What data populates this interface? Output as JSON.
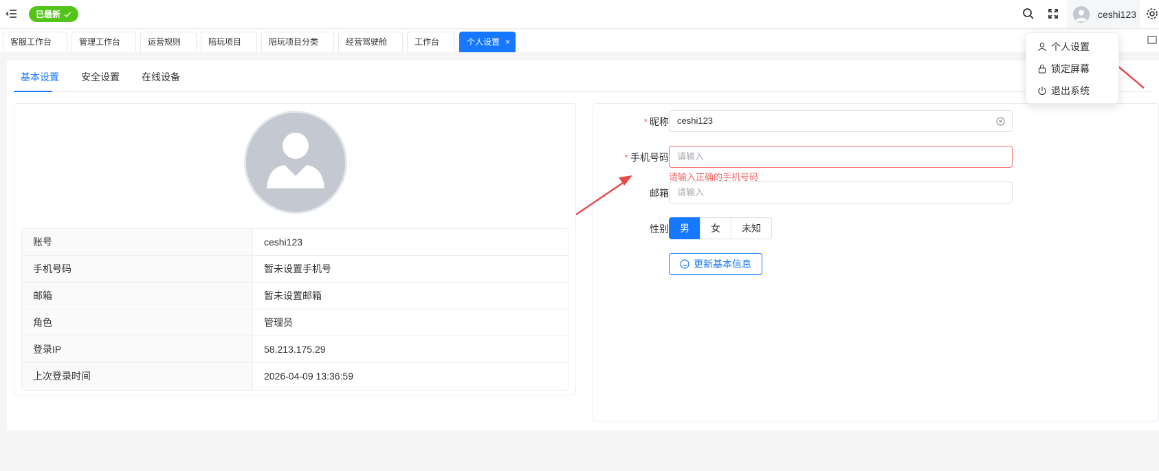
{
  "header": {
    "status_label": "已最新",
    "username": "ceshi123"
  },
  "tabs": [
    {
      "label": "客服工作台"
    },
    {
      "label": "管理工作台"
    },
    {
      "label": "运营规则"
    },
    {
      "label": "陪玩项目"
    },
    {
      "label": "陪玩项目分类"
    },
    {
      "label": "经营驾驶舱"
    },
    {
      "label": "工作台"
    },
    {
      "label": "个人设置",
      "close": "×"
    }
  ],
  "subtabs": [
    {
      "label": "基本设置"
    },
    {
      "label": "安全设置"
    },
    {
      "label": "在线设备"
    }
  ],
  "profile": {
    "rows": [
      {
        "label": "账号",
        "value": "ceshi123"
      },
      {
        "label": "手机号码",
        "value": "暂未设置手机号"
      },
      {
        "label": "邮箱",
        "value": "暂未设置邮箱"
      },
      {
        "label": "角色",
        "value": "管理员"
      },
      {
        "label": "登录IP",
        "value": "58.213.175.29"
      },
      {
        "label": "上次登录时间",
        "value": "2026-04-09 13:36:59"
      }
    ]
  },
  "form": {
    "required_mark": "*",
    "nickname_label": "昵称",
    "nickname_value": "ceshi123",
    "phone_label": "手机号码",
    "phone_placeholder": "请输入",
    "phone_error": "请输入正确的手机号码",
    "email_label": "邮箱",
    "email_placeholder": "请输入",
    "gender_label": "性别",
    "gender_options": [
      "男",
      "女",
      "未知"
    ],
    "gender_selected": "男",
    "update_label": "更新基本信息"
  },
  "dropdown": {
    "items": [
      {
        "label": "个人设置",
        "icon": "user-icon"
      },
      {
        "label": "锁定屏幕",
        "icon": "lock-icon"
      },
      {
        "label": "退出系统",
        "icon": "power-icon"
      }
    ]
  },
  "colors": {
    "primary": "#1677ff",
    "success": "#52c41a",
    "error": "#f56c6c",
    "arrow": "#e84a4a"
  }
}
